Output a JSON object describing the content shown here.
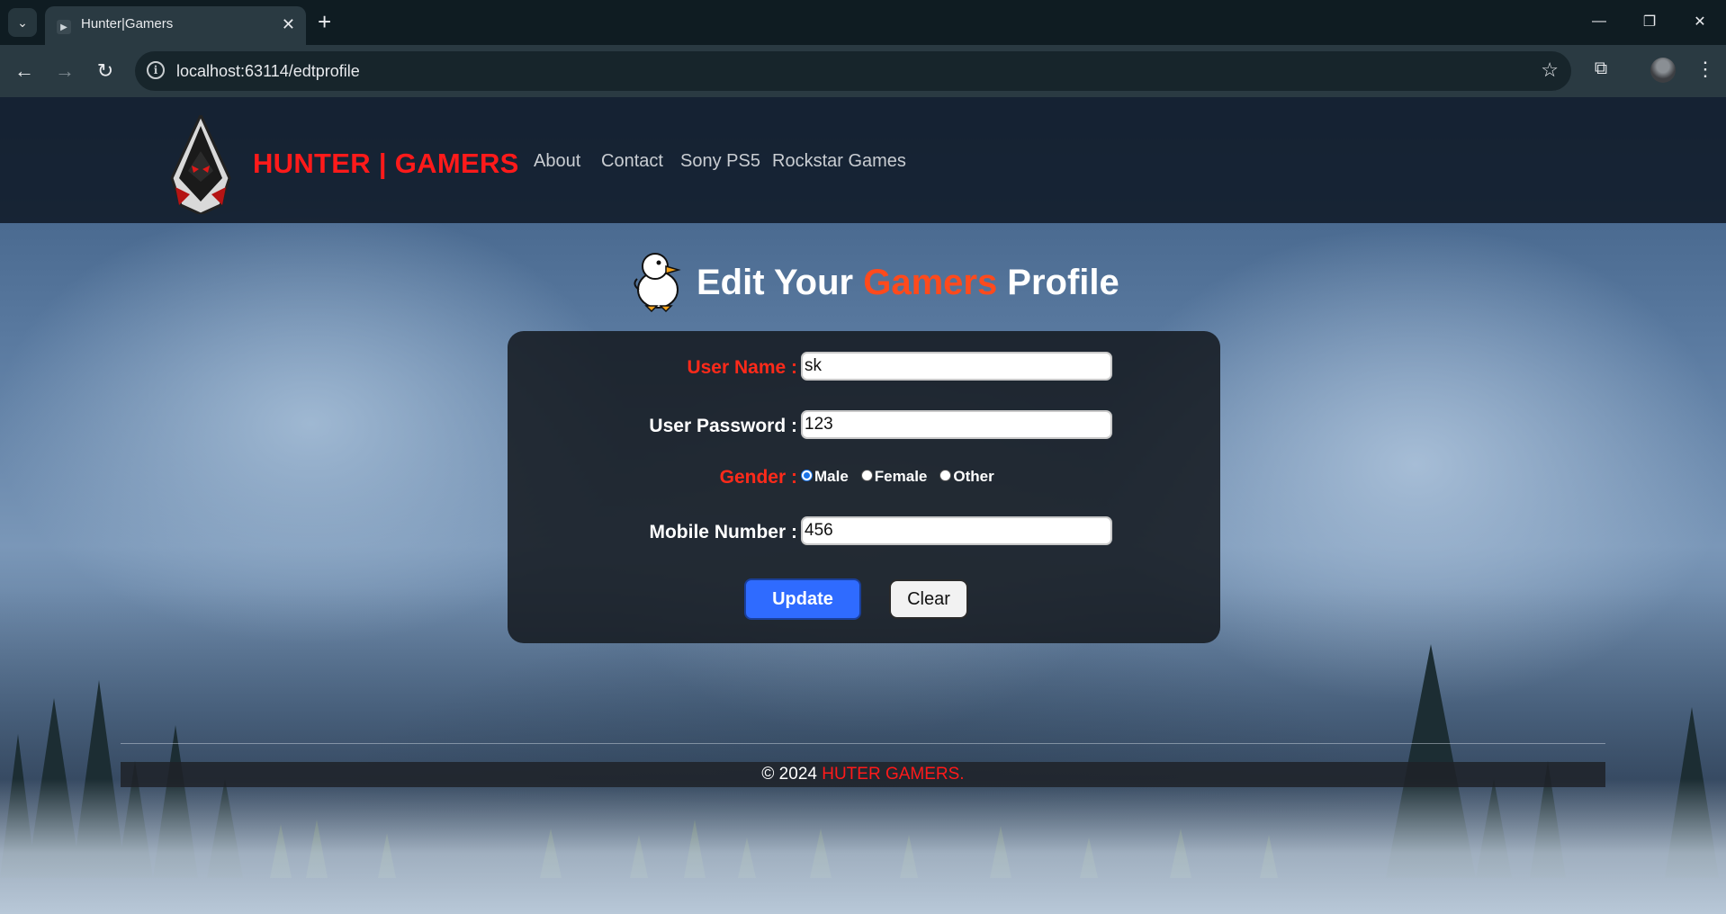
{
  "browser": {
    "tab_title": "Hunter|Gamers",
    "url": "localhost:63114/edtprofile"
  },
  "site": {
    "brand": "HUNTER | GAMERS",
    "nav": [
      "About",
      "Contact",
      "Sony PS5",
      "Rockstar Games"
    ]
  },
  "page": {
    "title_prefix": "Edit Your ",
    "title_accent": "Gamers",
    "title_suffix": " Profile"
  },
  "form": {
    "username_label": "User Name :",
    "username_value": "sk",
    "password_label": "User Password :",
    "password_value": "123",
    "gender_label": "Gender :",
    "gender_options": [
      "Male",
      "Female",
      "Other"
    ],
    "gender_selected": "Male",
    "mobile_label": "Mobile Number :",
    "mobile_value": "456",
    "update_label": "Update",
    "clear_label": "Clear"
  },
  "footer": {
    "copyright": "© 2024 ",
    "brand": "HUTER GAMERS."
  },
  "colors": {
    "brand_red": "#ff1a1a",
    "accent_orange": "#ff4a1c",
    "button_blue": "#2f6bff"
  },
  "icons": [
    "tab-search-icon",
    "playstation-favicon-icon",
    "close-icon",
    "plus-icon",
    "minimize-icon",
    "restore-icon",
    "back-arrow-icon",
    "forward-arrow-icon",
    "reload-icon",
    "info-icon",
    "star-icon",
    "extensions-icon",
    "more-vert-icon",
    "hooded-hunter-logo-icon",
    "duck-icon"
  ]
}
